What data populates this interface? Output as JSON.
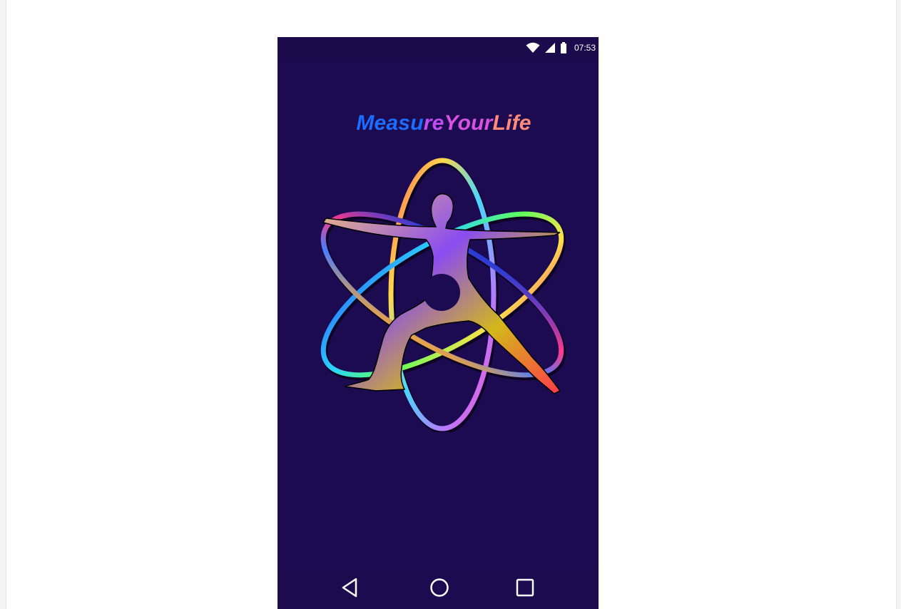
{
  "status_bar": {
    "time": "07:53",
    "icons": [
      "wifi-icon",
      "signal-icon",
      "battery-icon"
    ]
  },
  "app": {
    "title_parts": [
      "Measu",
      "re",
      "Your",
      "Life"
    ],
    "logo_icon": "atom-yoga-logo-icon"
  },
  "nav_bar": {
    "buttons": [
      "back-icon",
      "home-icon",
      "recent-apps-icon"
    ]
  },
  "colors": {
    "background": "#1d0b52",
    "title_blue": "#1b6cff",
    "title_purple": "#c14df2",
    "title_magenta": "#d852e0",
    "title_salmon": "#ff8a78"
  }
}
